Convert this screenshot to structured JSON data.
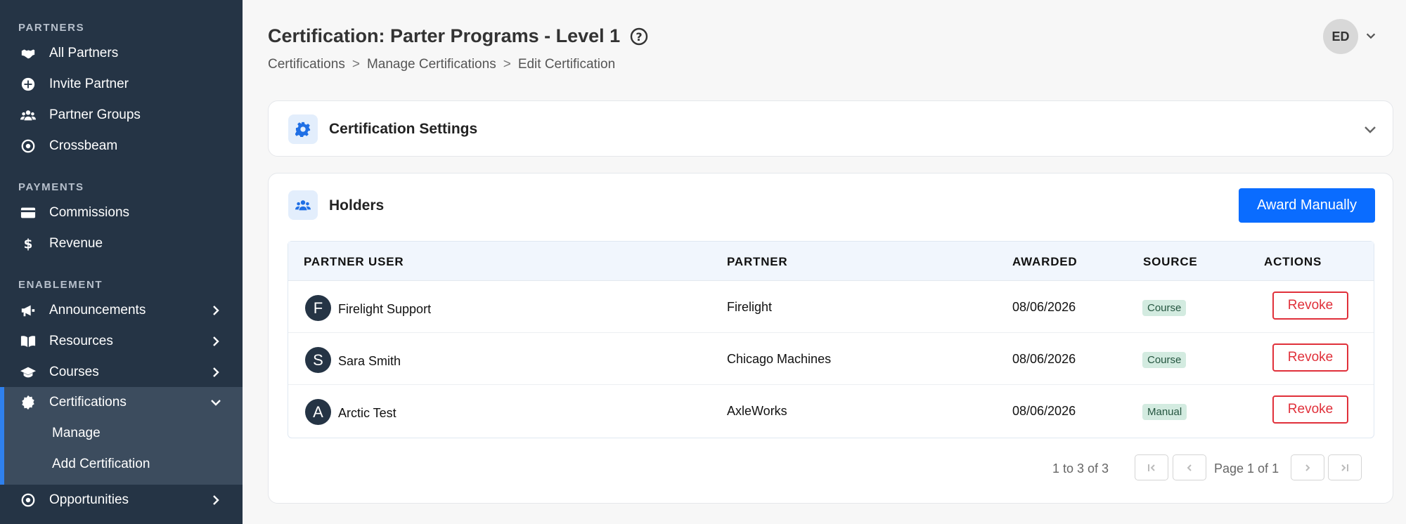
{
  "sidebar": {
    "sections": [
      {
        "title": "PARTNERS"
      },
      {
        "title": "PAYMENTS"
      },
      {
        "title": "ENABLEMENT"
      }
    ],
    "items": [
      {
        "label": "All Partners",
        "icon": "handshake-icon"
      },
      {
        "label": "Invite Partner",
        "icon": "plus-circle-icon"
      },
      {
        "label": "Partner Groups",
        "icon": "users-icon"
      },
      {
        "label": "Crossbeam",
        "icon": "target-icon"
      },
      {
        "label": "Commissions",
        "icon": "credit-card-icon"
      },
      {
        "label": "Revenue",
        "icon": "dollar-icon"
      },
      {
        "label": "Announcements",
        "icon": "megaphone-icon"
      },
      {
        "label": "Resources",
        "icon": "book-icon"
      },
      {
        "label": "Courses",
        "icon": "graduation-cap-icon"
      },
      {
        "label": "Certifications",
        "icon": "certificate-icon"
      },
      {
        "label": "Opportunities",
        "icon": "target-icon"
      }
    ],
    "sub_items": [
      {
        "label": "Manage"
      },
      {
        "label": "Add Certification"
      }
    ]
  },
  "header": {
    "title": "Certification: Parter Programs - Level 1",
    "breadcrumb": [
      "Certifications",
      "Manage Certifications",
      "Edit Certification"
    ],
    "breadcrumb_sep": ">",
    "user_initials": "ED"
  },
  "settings_card": {
    "title": "Certification Settings"
  },
  "holders_card": {
    "title": "Holders",
    "award_button": "Award Manually",
    "columns": [
      "PARTNER USER",
      "PARTNER",
      "AWARDED",
      "SOURCE",
      "ACTIONS"
    ],
    "rows": [
      {
        "initial": "F",
        "user": "Firelight Support",
        "partner": "Firelight",
        "awarded": "08/06/2026",
        "source": "Course",
        "action": "Revoke"
      },
      {
        "initial": "S",
        "user": "Sara Smith",
        "partner": "Chicago Machines",
        "awarded": "08/06/2026",
        "source": "Course",
        "action": "Revoke"
      },
      {
        "initial": "A",
        "user": "Arctic Test",
        "partner": "AxleWorks",
        "awarded": "08/06/2026",
        "source": "Manual",
        "action": "Revoke"
      }
    ],
    "pagination": {
      "range": "1 to 3 of 3",
      "page": "Page 1 of 1"
    }
  },
  "colors": {
    "sidebar_bg": "#253445",
    "accent": "#0a6cff",
    "danger": "#e0303a"
  }
}
